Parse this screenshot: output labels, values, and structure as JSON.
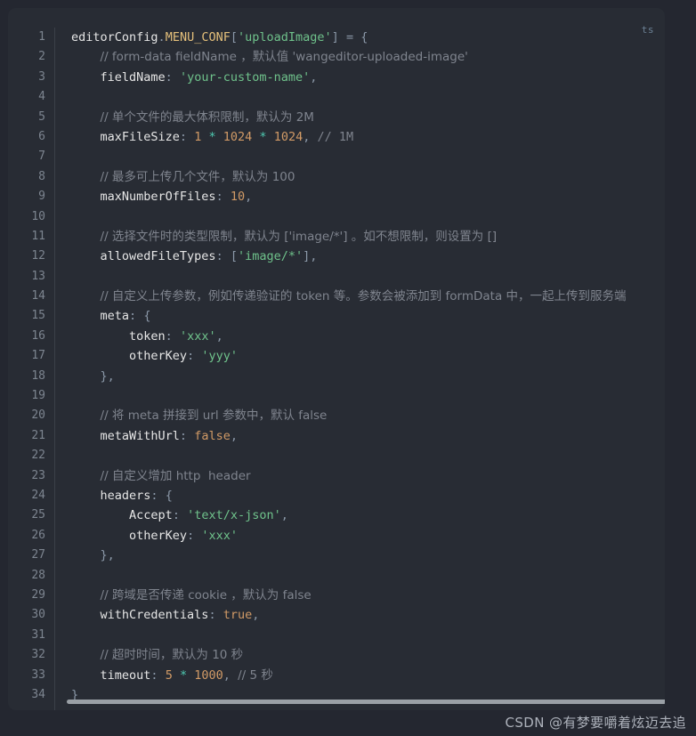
{
  "code_block": {
    "language_tag": "ts",
    "theme": {
      "page_background": "#242730",
      "card_background": "#282c34",
      "gutter_divider": "#3b4049",
      "line_number": "#7d8590",
      "plain": "#abb2bf",
      "comment": "#7f848e",
      "string": "#6fc28b",
      "number": "#d19a66",
      "boolean": "#d19a66",
      "constant": "#e5c07b",
      "punctuation": "#8b98a8",
      "operator": "#4ec9b0",
      "scrollbar_thumb": "#9aa0a6"
    },
    "line_numbers": [
      "1",
      "2",
      "3",
      "4",
      "5",
      "6",
      "7",
      "8",
      "9",
      "10",
      "11",
      "12",
      "13",
      "14",
      "15",
      "16",
      "17",
      "18",
      "19",
      "20",
      "21",
      "22",
      "23",
      "24",
      "25",
      "26",
      "27",
      "28",
      "29",
      "30",
      "31",
      "32",
      "33",
      "34"
    ],
    "lines": [
      {
        "n": 1,
        "text": "editorConfig.MENU_CONF['uploadImage'] = {"
      },
      {
        "n": 2,
        "text": "    // form-data fieldName ，默认值 'wangeditor-uploaded-image'"
      },
      {
        "n": 3,
        "text": "    fieldName: 'your-custom-name',"
      },
      {
        "n": 4,
        "text": ""
      },
      {
        "n": 5,
        "text": "    // 单个文件的最大体积限制，默认为 2M"
      },
      {
        "n": 6,
        "text": "    maxFileSize: 1 * 1024 * 1024, // 1M"
      },
      {
        "n": 7,
        "text": ""
      },
      {
        "n": 8,
        "text": "    // 最多可上传几个文件，默认为 100"
      },
      {
        "n": 9,
        "text": "    maxNumberOfFiles: 10,"
      },
      {
        "n": 10,
        "text": ""
      },
      {
        "n": 11,
        "text": "    // 选择文件时的类型限制，默认为 ['image/*'] 。如不想限制，则设置为 []"
      },
      {
        "n": 12,
        "text": "    allowedFileTypes: ['image/*'],"
      },
      {
        "n": 13,
        "text": ""
      },
      {
        "n": 14,
        "text": "    // 自定义上传参数，例如传递验证的 token 等。参数会被添加到 formData 中，一起上传到服务端"
      },
      {
        "n": 15,
        "text": "    meta: {"
      },
      {
        "n": 16,
        "text": "        token: 'xxx',"
      },
      {
        "n": 17,
        "text": "        otherKey: 'yyy'"
      },
      {
        "n": 18,
        "text": "    },"
      },
      {
        "n": 19,
        "text": ""
      },
      {
        "n": 20,
        "text": "    // 将 meta 拼接到 url 参数中，默认 false"
      },
      {
        "n": 21,
        "text": "    metaWithUrl: false,"
      },
      {
        "n": 22,
        "text": ""
      },
      {
        "n": 23,
        "text": "    // 自定义增加 http  header"
      },
      {
        "n": 24,
        "text": "    headers: {"
      },
      {
        "n": 25,
        "text": "        Accept: 'text/x-json',"
      },
      {
        "n": 26,
        "text": "        otherKey: 'xxx'"
      },
      {
        "n": 27,
        "text": "    },"
      },
      {
        "n": 28,
        "text": ""
      },
      {
        "n": 29,
        "text": "    // 跨域是否传递 cookie ，默认为 false"
      },
      {
        "n": 30,
        "text": "    withCredentials: true,"
      },
      {
        "n": 31,
        "text": ""
      },
      {
        "n": 32,
        "text": "    // 超时时间，默认为 10 秒"
      },
      {
        "n": 33,
        "text": "    timeout: 5 * 1000, // 5 秒"
      },
      {
        "n": 34,
        "text": "}"
      }
    ],
    "tokenized_lines": [
      [
        [
          "t-var",
          "editorConfig"
        ],
        [
          "t-punc",
          "."
        ],
        [
          "t-const",
          "MENU_CONF"
        ],
        [
          "t-punc",
          "["
        ],
        [
          "t-string",
          "'uploadImage'"
        ],
        [
          "t-punc",
          "]"
        ],
        [
          "t-plain",
          " "
        ],
        [
          "t-punc",
          "="
        ],
        [
          "t-plain",
          " "
        ],
        [
          "t-punc",
          "{"
        ]
      ],
      [
        [
          "t-plain",
          "    "
        ],
        [
          "t-comment",
          "// form-data fieldName ，默认值 'wangeditor-uploaded-image'"
        ]
      ],
      [
        [
          "t-plain",
          "    "
        ],
        [
          "t-prop",
          "fieldName"
        ],
        [
          "t-punc",
          ":"
        ],
        [
          "t-plain",
          " "
        ],
        [
          "t-string",
          "'your-custom-name'"
        ],
        [
          "t-punc",
          ","
        ]
      ],
      [],
      [
        [
          "t-plain",
          "    "
        ],
        [
          "t-comment",
          "// 单个文件的最大体积限制，默认为 2M"
        ]
      ],
      [
        [
          "t-plain",
          "    "
        ],
        [
          "t-prop",
          "maxFileSize"
        ],
        [
          "t-punc",
          ":"
        ],
        [
          "t-plain",
          " "
        ],
        [
          "t-num",
          "1"
        ],
        [
          "t-plain",
          " "
        ],
        [
          "t-op",
          "*"
        ],
        [
          "t-plain",
          " "
        ],
        [
          "t-num",
          "1024"
        ],
        [
          "t-plain",
          " "
        ],
        [
          "t-op",
          "*"
        ],
        [
          "t-plain",
          " "
        ],
        [
          "t-num",
          "1024"
        ],
        [
          "t-punc",
          ","
        ],
        [
          "t-plain",
          " "
        ],
        [
          "t-comment",
          "// 1M"
        ]
      ],
      [],
      [
        [
          "t-plain",
          "    "
        ],
        [
          "t-comment",
          "// 最多可上传几个文件，默认为 100"
        ]
      ],
      [
        [
          "t-plain",
          "    "
        ],
        [
          "t-prop",
          "maxNumberOfFiles"
        ],
        [
          "t-punc",
          ":"
        ],
        [
          "t-plain",
          " "
        ],
        [
          "t-num",
          "10"
        ],
        [
          "t-punc",
          ","
        ]
      ],
      [],
      [
        [
          "t-plain",
          "    "
        ],
        [
          "t-comment",
          "// 选择文件时的类型限制，默认为 ['image/*'] 。如不想限制，则设置为 []"
        ]
      ],
      [
        [
          "t-plain",
          "    "
        ],
        [
          "t-prop",
          "allowedFileTypes"
        ],
        [
          "t-punc",
          ":"
        ],
        [
          "t-plain",
          " "
        ],
        [
          "t-punc",
          "["
        ],
        [
          "t-string",
          "'image/*'"
        ],
        [
          "t-punc",
          "],"
        ]
      ],
      [],
      [
        [
          "t-plain",
          "    "
        ],
        [
          "t-comment",
          "// 自定义上传参数，例如传递验证的 token 等。参数会被添加到 formData 中，一起上传到服务端"
        ]
      ],
      [
        [
          "t-plain",
          "    "
        ],
        [
          "t-prop",
          "meta"
        ],
        [
          "t-punc",
          ":"
        ],
        [
          "t-plain",
          " "
        ],
        [
          "t-punc",
          "{"
        ]
      ],
      [
        [
          "t-plain",
          "        "
        ],
        [
          "t-prop",
          "token"
        ],
        [
          "t-punc",
          ":"
        ],
        [
          "t-plain",
          " "
        ],
        [
          "t-string",
          "'xxx'"
        ],
        [
          "t-punc",
          ","
        ]
      ],
      [
        [
          "t-plain",
          "        "
        ],
        [
          "t-prop",
          "otherKey"
        ],
        [
          "t-punc",
          ":"
        ],
        [
          "t-plain",
          " "
        ],
        [
          "t-string",
          "'yyy'"
        ]
      ],
      [
        [
          "t-plain",
          "    "
        ],
        [
          "t-punc",
          "},"
        ]
      ],
      [],
      [
        [
          "t-plain",
          "    "
        ],
        [
          "t-comment",
          "// 将 meta 拼接到 url 参数中，默认 false"
        ]
      ],
      [
        [
          "t-plain",
          "    "
        ],
        [
          "t-prop",
          "metaWithUrl"
        ],
        [
          "t-punc",
          ":"
        ],
        [
          "t-plain",
          " "
        ],
        [
          "t-bool",
          "false"
        ],
        [
          "t-punc",
          ","
        ]
      ],
      [],
      [
        [
          "t-plain",
          "    "
        ],
        [
          "t-comment",
          "// 自定义增加 http  header"
        ]
      ],
      [
        [
          "t-plain",
          "    "
        ],
        [
          "t-prop",
          "headers"
        ],
        [
          "t-punc",
          ":"
        ],
        [
          "t-plain",
          " "
        ],
        [
          "t-punc",
          "{"
        ]
      ],
      [
        [
          "t-plain",
          "        "
        ],
        [
          "t-prop",
          "Accept"
        ],
        [
          "t-punc",
          ":"
        ],
        [
          "t-plain",
          " "
        ],
        [
          "t-string",
          "'text/x-json'"
        ],
        [
          "t-punc",
          ","
        ]
      ],
      [
        [
          "t-plain",
          "        "
        ],
        [
          "t-prop",
          "otherKey"
        ],
        [
          "t-punc",
          ":"
        ],
        [
          "t-plain",
          " "
        ],
        [
          "t-string",
          "'xxx'"
        ]
      ],
      [
        [
          "t-plain",
          "    "
        ],
        [
          "t-punc",
          "},"
        ]
      ],
      [],
      [
        [
          "t-plain",
          "    "
        ],
        [
          "t-comment",
          "// 跨域是否传递 cookie ，默认为 false"
        ]
      ],
      [
        [
          "t-plain",
          "    "
        ],
        [
          "t-prop",
          "withCredentials"
        ],
        [
          "t-punc",
          ":"
        ],
        [
          "t-plain",
          " "
        ],
        [
          "t-bool",
          "true"
        ],
        [
          "t-punc",
          ","
        ]
      ],
      [],
      [
        [
          "t-plain",
          "    "
        ],
        [
          "t-comment",
          "// 超时时间，默认为 10 秒"
        ]
      ],
      [
        [
          "t-plain",
          "    "
        ],
        [
          "t-prop",
          "timeout"
        ],
        [
          "t-punc",
          ":"
        ],
        [
          "t-plain",
          " "
        ],
        [
          "t-num",
          "5"
        ],
        [
          "t-plain",
          " "
        ],
        [
          "t-op",
          "*"
        ],
        [
          "t-plain",
          " "
        ],
        [
          "t-num",
          "1000"
        ],
        [
          "t-punc",
          ","
        ],
        [
          "t-plain",
          " "
        ],
        [
          "t-comment",
          "// 5 秒"
        ]
      ],
      [
        [
          "t-punc",
          "}"
        ]
      ]
    ]
  },
  "watermark": {
    "text": "CSDN @有梦要嚼着炫迈去追"
  },
  "scrollbar": {
    "orientation": "horizontal",
    "thumb_ratio": 0.93
  }
}
